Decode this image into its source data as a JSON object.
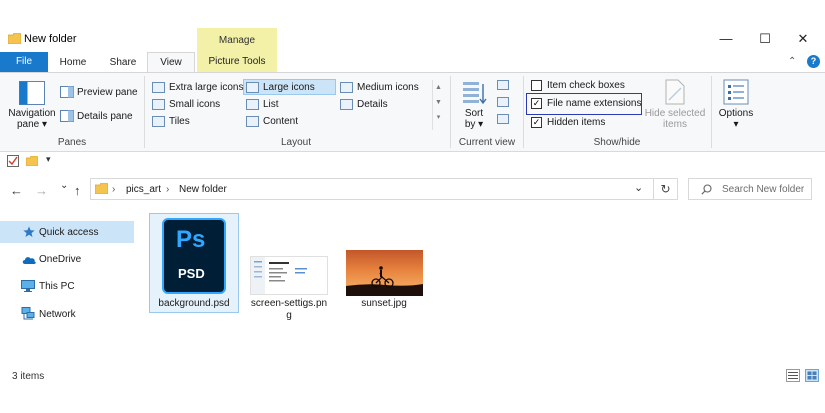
{
  "window": {
    "title": "New folder",
    "controls": {
      "minimize": "—",
      "maximize": "☐",
      "close": "✕"
    }
  },
  "tabs": {
    "file": "File",
    "home": "Home",
    "share": "Share",
    "view": "View",
    "context_group": "Manage",
    "picture_tools": "Picture Tools",
    "collapse": "⌃",
    "help": "?"
  },
  "ribbon": {
    "panes": {
      "label": "Panes",
      "navigation_pane": [
        "Navigation",
        "pane ▾"
      ],
      "preview_pane": "Preview pane",
      "details_pane": "Details pane"
    },
    "layout": {
      "label": "Layout",
      "items": {
        "extra_large_icons": "Extra large icons",
        "large_icons": "Large icons",
        "medium_icons": "Medium icons",
        "small_icons": "Small icons",
        "list": "List",
        "details": "Details",
        "tiles": "Tiles",
        "content": "Content"
      }
    },
    "current_view": {
      "label": "Current view",
      "sort_by": [
        "Sort",
        "by ▾"
      ]
    },
    "show_hide": {
      "label": "Show/hide",
      "item_check_boxes": {
        "label": "Item check boxes",
        "checked": false
      },
      "file_name_extensions": {
        "label": "File name extensions",
        "checked": true
      },
      "hidden_items": {
        "label": "Hidden items",
        "checked": true
      },
      "hide_selected_items": [
        "Hide selected",
        "items"
      ]
    },
    "options": {
      "label": "Options",
      "arrow": "▾"
    }
  },
  "address": {
    "back": "←",
    "forward": "→",
    "recent": "⌄",
    "up": "↑",
    "path": [
      "pics_art",
      "New folder"
    ],
    "separator": "›",
    "dropdown": "⌄",
    "refresh": "↻"
  },
  "search": {
    "placeholder": "Search New folder"
  },
  "nav_pane": {
    "items": [
      "Quick access",
      "OneDrive",
      "This PC",
      "Network"
    ]
  },
  "files": [
    {
      "name": "background.psd",
      "icon_text": "Ps",
      "badge": "PSD",
      "selected": true
    },
    {
      "name_lines": [
        "screen-settigs.pn",
        "g"
      ],
      "selected": false
    },
    {
      "name": "sunset.jpg",
      "selected": false
    }
  ],
  "status": {
    "count": "3 items"
  },
  "colors": {
    "accent": "#1979ca",
    "selection": "#cce4f7",
    "context_tab": "#f3f0a7",
    "highlight_box": "#2a3ab5",
    "ps_dark": "#001e36",
    "ps_blue": "#31a8ff"
  }
}
